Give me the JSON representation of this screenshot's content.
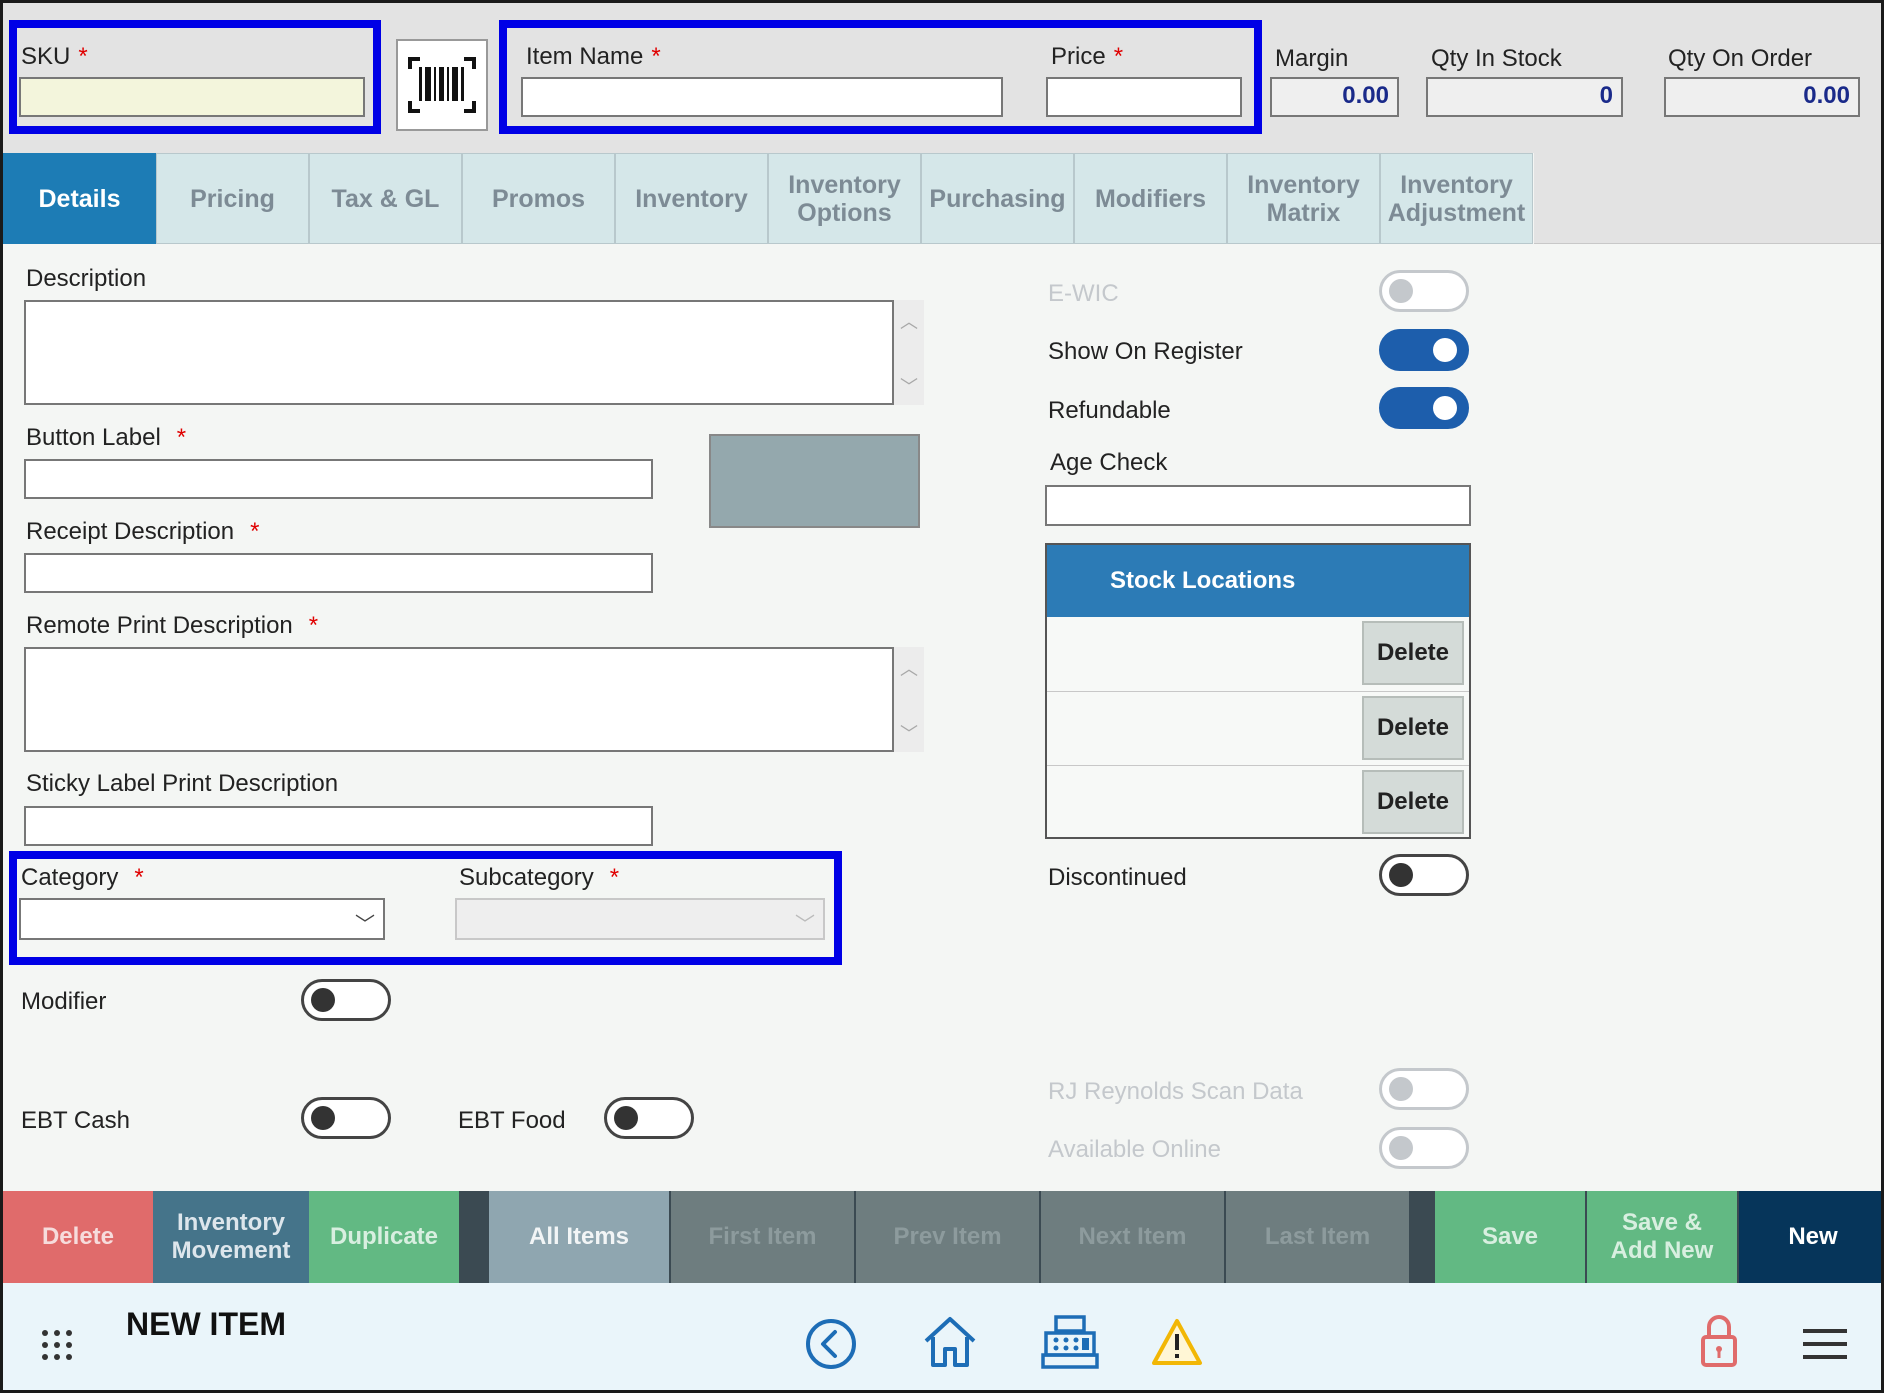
{
  "header": {
    "sku_label": "SKU",
    "barcode_icon": "barcode-icon",
    "item_name_label": "Item Name",
    "price_label": "Price",
    "margin_label": "Margin",
    "margin_value": "0.00",
    "qty_in_stock_label": "Qty In Stock",
    "qty_in_stock_value": "0",
    "qty_on_order_label": "Qty On Order",
    "qty_on_order_value": "0.00",
    "required_mark": "*",
    "highlight_color": "#0000e6"
  },
  "tabs": [
    {
      "label": "Details",
      "active": true
    },
    {
      "label": "Pricing"
    },
    {
      "label": "Tax & GL"
    },
    {
      "label": "Promos"
    },
    {
      "label": "Inventory"
    },
    {
      "label": "Inventory\nOptions"
    },
    {
      "label": "Purchasing"
    },
    {
      "label": "Modifiers"
    },
    {
      "label": "Inventory\nMatrix"
    },
    {
      "label": "Inventory\nAdjustment"
    }
  ],
  "details": {
    "description_label": "Description",
    "button_label_label": "Button Label",
    "receipt_description_label": "Receipt Description",
    "remote_print_description_label": "Remote Print Description",
    "sticky_label_label": "Sticky Label Print Description",
    "category_label": "Category",
    "subcategory_label": "Subcategory",
    "modifier_label": "Modifier",
    "ebt_cash_label": "EBT Cash",
    "ebt_food_label": "EBT Food",
    "ewic_label": "E-WIC",
    "show_on_register_label": "Show On Register",
    "refundable_label": "Refundable",
    "age_check_label": "Age Check",
    "discontinued_label": "Discontinued",
    "rj_reynolds_label": "RJ Reynolds Scan Data",
    "available_online_label": "Available Online",
    "toggles": {
      "ewic": false,
      "show_on_register": true,
      "refundable": true,
      "discontinued": false,
      "modifier": false,
      "ebt_cash": false,
      "ebt_food": false,
      "rj_reynolds": false,
      "available_online": false
    },
    "button_color": "#94a8ad"
  },
  "stock_locations": {
    "title": "Stock Locations",
    "rows": [
      {
        "name": "",
        "delete_label": "Delete"
      },
      {
        "name": "",
        "delete_label": "Delete"
      },
      {
        "name": "",
        "delete_label": "Delete"
      }
    ]
  },
  "action_bar": {
    "delete": "Delete",
    "inventory_movement": "Inventory\nMovement",
    "duplicate": "Duplicate",
    "all_items": "All Items",
    "first_item": "First Item",
    "prev_item": "Prev Item",
    "next_item": "Next Item",
    "last_item": "Last Item",
    "save": "Save",
    "save_add_new": "Save &\nAdd New",
    "new": "New"
  },
  "footer": {
    "title": "NEW ITEM",
    "icons": [
      "apps-grid-icon",
      "back-icon",
      "home-icon",
      "cash-register-icon",
      "warning-icon",
      "lock-icon",
      "hamburger-menu-icon"
    ]
  }
}
